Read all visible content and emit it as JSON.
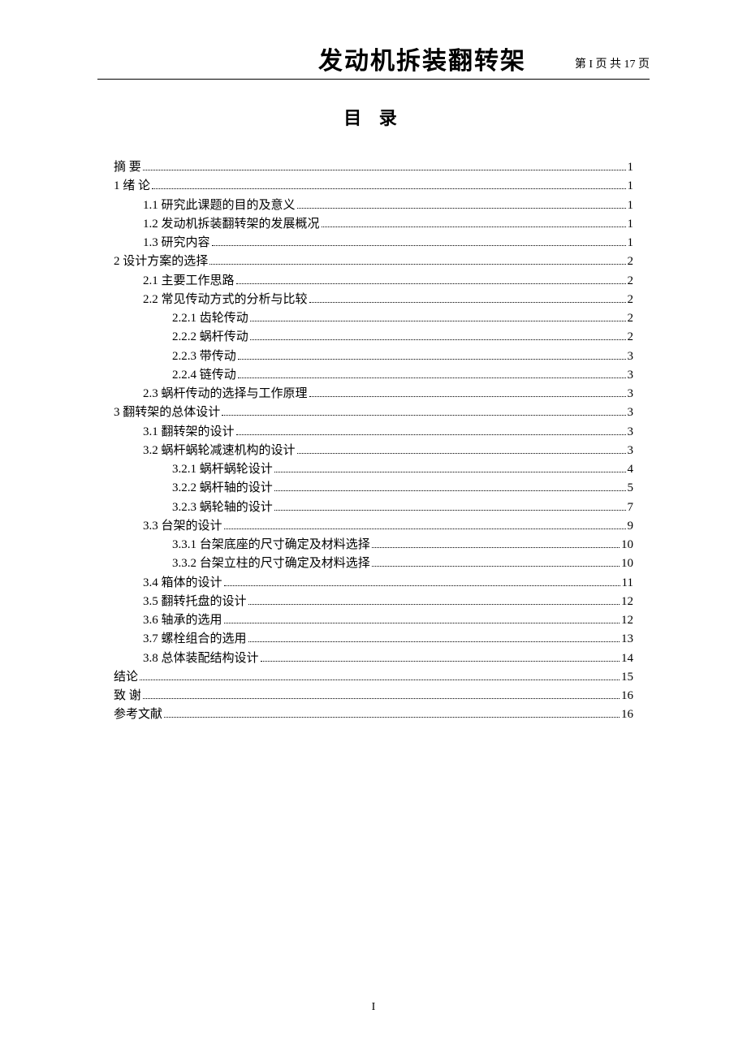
{
  "header": {
    "title": "发动机拆装翻转架",
    "page_indicator": "第 I 页  共 17 页"
  },
  "toc_title": "目 录",
  "toc": [
    {
      "level": 0,
      "label": "摘 要",
      "page": "1"
    },
    {
      "level": 0,
      "label": "1 绪 论",
      "page": "1"
    },
    {
      "level": 1,
      "label": "1.1 研究此课题的目的及意义",
      "page": "1"
    },
    {
      "level": 1,
      "label": "1.2 发动机拆装翻转架的发展概况",
      "page": "1"
    },
    {
      "level": 1,
      "label": "1.3 研究内容",
      "page": "1"
    },
    {
      "level": 0,
      "label": "2 设计方案的选择",
      "page": "2"
    },
    {
      "level": 1,
      "label": "2.1 主要工作思路",
      "page": "2"
    },
    {
      "level": 1,
      "label": "2.2 常见传动方式的分析与比较",
      "page": "2"
    },
    {
      "level": 2,
      "label": "2.2.1 齿轮传动",
      "page": "2"
    },
    {
      "level": 2,
      "label": "2.2.2 蜗杆传动",
      "page": "2"
    },
    {
      "level": 2,
      "label": "2.2.3 带传动",
      "page": "3"
    },
    {
      "level": 2,
      "label": "2.2.4 链传动",
      "page": "3"
    },
    {
      "level": 1,
      "label": "2.3 蜗杆传动的选择与工作原理",
      "page": "3"
    },
    {
      "level": 0,
      "label": "3 翻转架的总体设计",
      "page": "3"
    },
    {
      "level": 1,
      "label": "3.1 翻转架的设计",
      "page": "3"
    },
    {
      "level": 1,
      "label": "3.2 蜗杆蜗轮减速机构的设计",
      "page": "3"
    },
    {
      "level": 2,
      "label": "3.2.1 蜗杆蜗轮设计",
      "page": "4"
    },
    {
      "level": 2,
      "label": "3.2.2 蜗杆轴的设计",
      "page": "5"
    },
    {
      "level": 2,
      "label": "3.2.3 蜗轮轴的设计",
      "page": "7"
    },
    {
      "level": 1,
      "label": "3.3 台架的设计",
      "page": "9"
    },
    {
      "level": 2,
      "label": "3.3.1 台架底座的尺寸确定及材料选择",
      "page": "10"
    },
    {
      "level": 2,
      "label": "3.3.2 台架立柱的尺寸确定及材料选择",
      "page": "10"
    },
    {
      "level": 1,
      "label": "3.4 箱体的设计",
      "page": "11"
    },
    {
      "level": 1,
      "label": "3.5 翻转托盘的设计",
      "page": "12"
    },
    {
      "level": 1,
      "label": "3.6 轴承的选用",
      "page": "12"
    },
    {
      "level": 1,
      "label": "3.7 螺栓组合的选用",
      "page": "13"
    },
    {
      "level": 1,
      "label": "3.8 总体装配结构设计",
      "page": "14"
    },
    {
      "level": 0,
      "label": "结论",
      "page": "15"
    },
    {
      "level": 0,
      "label": "致 谢",
      "page": "16"
    },
    {
      "level": 0,
      "label": "参考文献",
      "page": "16"
    }
  ],
  "footer_page": "I"
}
